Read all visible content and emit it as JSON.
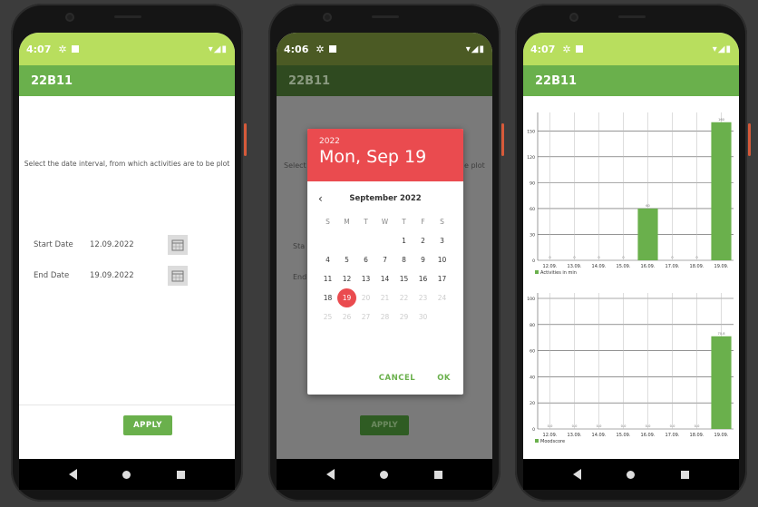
{
  "phones": [
    {
      "status_time": "4:07",
      "app_title": "22B11",
      "instruction": "Select the date interval, from which activities are to be plot",
      "start_label": "Start Date",
      "start_value": "12.09.2022",
      "end_label": "End Date",
      "end_value": "19.09.2022",
      "apply_label": "APPLY"
    },
    {
      "status_time": "4:06",
      "app_title": "22B11",
      "ghost_select": "Select",
      "ghost_plot": "e plot",
      "ghost_start": "Sta",
      "ghost_end": "End",
      "apply_label": "APPLY",
      "dialog": {
        "year": "2022",
        "date": "Mon, Sep 19",
        "month_title": "September 2022",
        "weekdays": [
          "S",
          "M",
          "T",
          "W",
          "T",
          "F",
          "S"
        ],
        "weeks": [
          [
            "",
            "",
            "",
            "",
            "1",
            "2",
            "3"
          ],
          [
            "4",
            "5",
            "6",
            "7",
            "8",
            "9",
            "10"
          ],
          [
            "11",
            "12",
            "13",
            "14",
            "15",
            "16",
            "17"
          ],
          [
            "18",
            "19",
            "20",
            "21",
            "22",
            "23",
            "24"
          ],
          [
            "25",
            "26",
            "27",
            "28",
            "29",
            "30",
            ""
          ]
        ],
        "selected_day": "19",
        "first_disabled_day": 20,
        "cancel_label": "CANCEL",
        "ok_label": "OK"
      }
    },
    {
      "status_time": "4:07",
      "app_title": "22B11"
    }
  ],
  "chart_data": [
    {
      "type": "bar",
      "categories": [
        "12.09.",
        "13.09.",
        "14.09.",
        "15.09.",
        "16.09.",
        "17.09.",
        "18.09.",
        "19.09."
      ],
      "series": [
        {
          "name": "Activities in min",
          "values": [
            0,
            0,
            0,
            0,
            60,
            0,
            0,
            160
          ],
          "color": "#6ab04c"
        }
      ],
      "data_labels": [
        "0",
        "0",
        "0",
        "0",
        "60",
        "0",
        "0",
        "160"
      ],
      "yticks": [
        0,
        30,
        60,
        90,
        120,
        150
      ],
      "ylim": [
        0,
        165
      ],
      "grid": true,
      "legend": "bottom-left"
    },
    {
      "type": "bar",
      "categories": [
        "12.09.",
        "13.09.",
        "14.09.",
        "15.09.",
        "16.09.",
        "17.09.",
        "18.09.",
        "19.09."
      ],
      "series": [
        {
          "name": "Moodscore",
          "values": [
            0,
            0,
            0,
            0,
            0,
            0,
            0,
            71
          ],
          "color": "#6ab04c"
        }
      ],
      "data_labels": [
        "0.0",
        "0.0",
        "0.0",
        "0.0",
        "0.0",
        "0.0",
        "0.0",
        "70.8"
      ],
      "yticks": [
        0,
        20,
        40,
        60,
        80,
        100
      ],
      "ylim": [
        0,
        100
      ],
      "grid": true,
      "legend": "bottom-left"
    }
  ]
}
